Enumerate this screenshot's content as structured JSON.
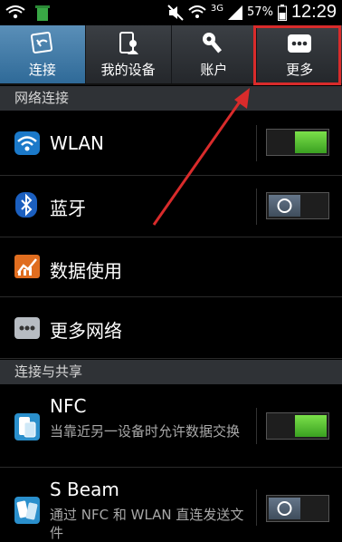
{
  "status_bar": {
    "network_type": "3G",
    "battery_percent": "57%",
    "time": "12:29"
  },
  "tabs": [
    {
      "label": "连接",
      "icon": "connect-icon",
      "active": true
    },
    {
      "label": "我的设备",
      "icon": "my-device-icon",
      "active": false
    },
    {
      "label": "账户",
      "icon": "account-key-icon",
      "active": false
    },
    {
      "label": "更多",
      "icon": "more-dots-icon",
      "active": false
    }
  ],
  "sections": {
    "network": "网络连接",
    "share": "连接与共享"
  },
  "items": {
    "wlan": {
      "label": "WLAN",
      "toggle": "on"
    },
    "bluetooth": {
      "label": "蓝牙",
      "toggle": "off"
    },
    "data_usage": {
      "label": "数据使用"
    },
    "more_networks": {
      "label": "更多网络"
    },
    "nfc": {
      "label": "NFC",
      "desc": "当靠近另一设备时允许数据交换",
      "toggle": "on"
    },
    "sbeam": {
      "label": "S Beam",
      "desc": "通过 NFC 和 WLAN 直连发送文件",
      "toggle": "off"
    }
  },
  "colors": {
    "accent_tab": "#3d7aa8",
    "toggle_on": "#5cc736",
    "toggle_off": "#4d5d6e",
    "highlight": "#d92b2b"
  }
}
